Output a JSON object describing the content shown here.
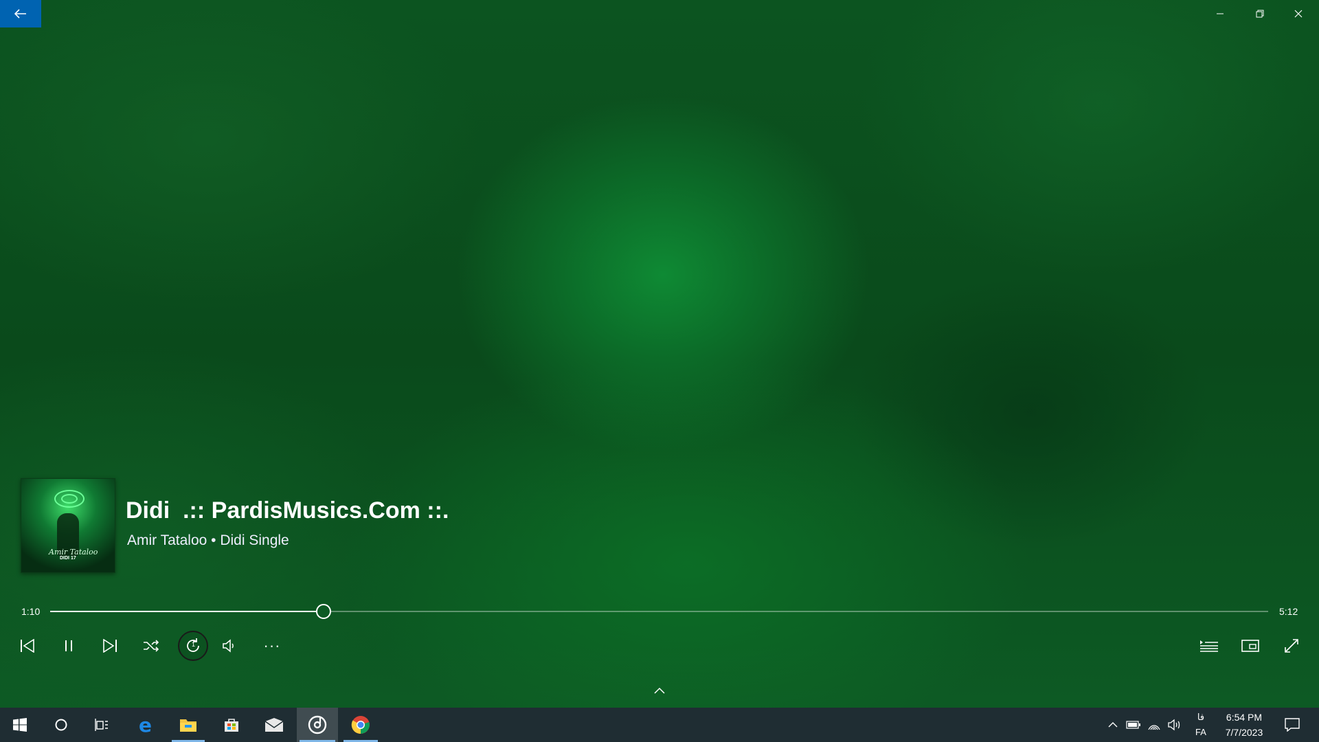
{
  "player": {
    "title": "Didi  .:: PardisMusics.Com ::.",
    "subtitle": "Amir Tataloo • Didi Single",
    "elapsed": "1:10",
    "total": "5:12",
    "progress_fraction": 0.2244,
    "album_art_text": "Amir Tataloo",
    "album_art_subtext": "DIDI 17"
  },
  "window": {
    "back_icon": "arrow-left-icon",
    "minimize_icon": "minimize-icon",
    "maximize_icon": "restore-icon",
    "close_icon": "close-icon",
    "accent_color": "#0063b1"
  },
  "controls": {
    "left": [
      "previous-icon",
      "pause-icon",
      "next-icon",
      "shuffle-icon",
      "repeat-one-icon",
      "volume-icon",
      "more-icon"
    ],
    "right": [
      "now-playing-list-icon",
      "mini-view-icon",
      "fullscreen-icon"
    ],
    "repeat_badge": "1",
    "more_label": "···"
  },
  "taskbar": {
    "apps": [
      "windows-start-icon",
      "cortana-icon",
      "task-view-icon",
      "edge-icon",
      "file-explorer-icon",
      "store-icon",
      "mail-icon",
      "groove-music-icon",
      "chrome-icon"
    ],
    "tray": [
      "show-hidden-icons-icon",
      "battery-icon",
      "wifi-icon",
      "speaker-icon"
    ],
    "lang_top": "فا",
    "lang_bottom": "FA",
    "time": "6:54 PM",
    "date": "7/7/2023",
    "notification_icon": "action-center-icon"
  }
}
